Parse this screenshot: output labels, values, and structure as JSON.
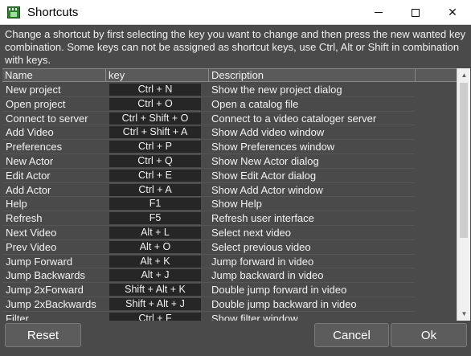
{
  "window": {
    "title": "Shortcuts",
    "minimize": "—",
    "maximize": "☐",
    "close": "✕"
  },
  "instructions": "Change a shortcut by first selecting the key you want to change and then press the new wanted key combination. Some keys can not be assigned as shortcut keys, use Ctrl, Alt or Shift in combination with keys.",
  "table": {
    "headers": {
      "name": "Name",
      "key": "key",
      "description": "Description"
    },
    "rows": [
      {
        "name": "New project",
        "key": "Ctrl + N",
        "description": "Show the new project dialog"
      },
      {
        "name": "Open project",
        "key": "Ctrl + O",
        "description": "Open a catalog file"
      },
      {
        "name": "Connect to server",
        "key": "Ctrl + Shift + O",
        "description": "Connect to a video cataloger server"
      },
      {
        "name": "Add Video",
        "key": "Ctrl + Shift + A",
        "description": "Show Add video window"
      },
      {
        "name": "Preferences",
        "key": "Ctrl + P",
        "description": "Show Preferences window"
      },
      {
        "name": "New Actor",
        "key": "Ctrl + Q",
        "description": "Show New Actor dialog"
      },
      {
        "name": "Edit Actor",
        "key": "Ctrl + E",
        "description": "Show Edit Actor dialog"
      },
      {
        "name": "Add Actor",
        "key": "Ctrl + A",
        "description": "Show Add Actor window"
      },
      {
        "name": "Help",
        "key": "F1",
        "description": "Show Help"
      },
      {
        "name": "Refresh",
        "key": "F5",
        "description": "Refresh user interface"
      },
      {
        "name": "Next Video",
        "key": "Alt + L",
        "description": "Select next video"
      },
      {
        "name": "Prev Video",
        "key": "Alt + O",
        "description": "Select previous video"
      },
      {
        "name": "Jump Forward",
        "key": "Alt + K",
        "description": "Jump forward in video"
      },
      {
        "name": "Jump Backwards",
        "key": "Alt + J",
        "description": "Jump backward in video"
      },
      {
        "name": "Jump 2xForward",
        "key": "Shift + Alt + K",
        "description": "Double jump forward in video"
      },
      {
        "name": "Jump 2xBackwards",
        "key": "Shift + Alt + J",
        "description": "Double jump backward in video"
      },
      {
        "name": "Filter",
        "key": "Ctrl + F",
        "description": "Show filter window"
      }
    ]
  },
  "buttons": {
    "reset": "Reset",
    "cancel": "Cancel",
    "ok": "Ok"
  },
  "scrollbar": {
    "up": "▲",
    "down": "▼",
    "position_fraction": 0.0
  },
  "colors": {
    "background": "#4a4a4a",
    "key_cell": "#262626",
    "text": "#f2f2f2"
  }
}
